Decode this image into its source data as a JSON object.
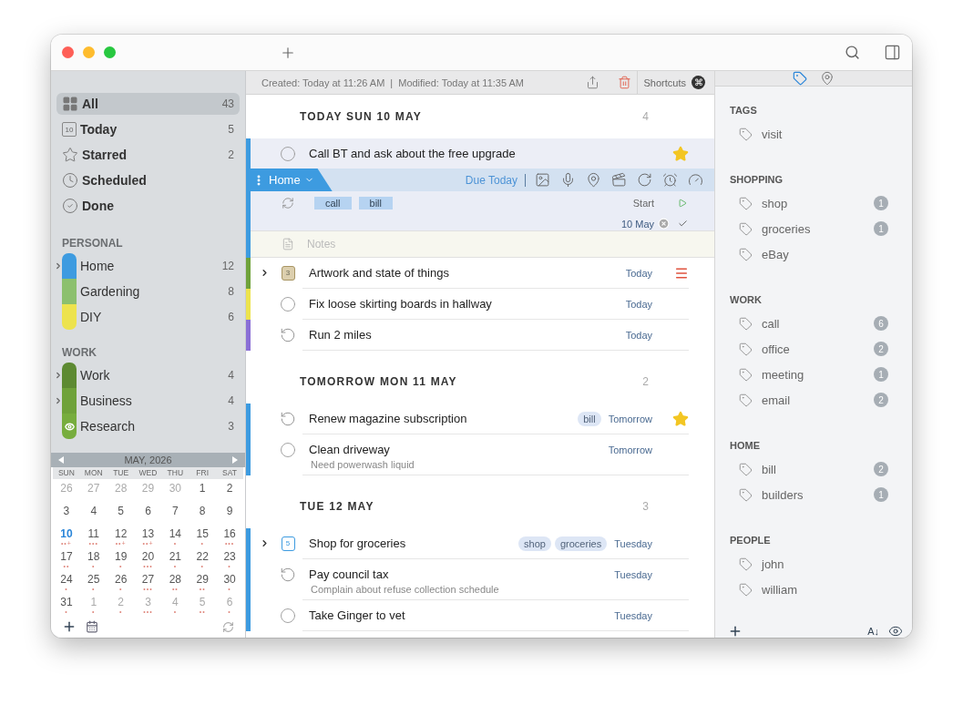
{
  "sidebar": {
    "smart_lists": [
      {
        "kind": "all",
        "label": "All",
        "count": "43",
        "selected": true
      },
      {
        "kind": "today",
        "label": "Today",
        "count": "5",
        "icon_text": "10",
        "selected": false
      },
      {
        "kind": "starred",
        "label": "Starred",
        "count": "2",
        "selected": false
      },
      {
        "kind": "scheduled",
        "label": "Scheduled",
        "selected": false
      },
      {
        "kind": "done",
        "label": "Done",
        "selected": false
      }
    ],
    "groups": [
      {
        "title": "PERSONAL",
        "lists": [
          {
            "label": "Home",
            "count": "12",
            "color": "#3d9be0",
            "expandable": true,
            "watched": false
          },
          {
            "label": "Gardening",
            "count": "8",
            "color": "#8cc06e",
            "expandable": false,
            "watched": false
          },
          {
            "label": "DIY",
            "count": "6",
            "color": "#ede34e",
            "expandable": false,
            "watched": false
          }
        ]
      },
      {
        "title": "WORK",
        "lists": [
          {
            "label": "Work",
            "count": "4",
            "color": "#5d8a32",
            "expandable": true,
            "watched": false
          },
          {
            "label": "Business",
            "count": "4",
            "color": "#6fa23a",
            "expandable": true,
            "watched": false
          },
          {
            "label": "Research",
            "count": "3",
            "color": "#77ad3e",
            "expandable": false,
            "watched": true
          }
        ]
      }
    ],
    "calendar": {
      "month": "MAY, 2026",
      "weekdays": [
        "SUN",
        "MON",
        "TUE",
        "WED",
        "THU",
        "FRI",
        "SAT"
      ],
      "weeks": [
        [
          {
            "day": "26",
            "in_month": false,
            "today": false
          },
          {
            "day": "27",
            "in_month": false,
            "today": false
          },
          {
            "day": "28",
            "in_month": false,
            "today": false
          },
          {
            "day": "29",
            "in_month": false,
            "today": false
          },
          {
            "day": "30",
            "in_month": false,
            "today": false
          },
          {
            "day": "1",
            "in_month": true,
            "today": false
          },
          {
            "day": "2",
            "in_month": true,
            "today": false
          }
        ],
        [
          {
            "day": "3",
            "in_month": true,
            "today": false
          },
          {
            "day": "4",
            "in_month": true,
            "today": false
          },
          {
            "day": "5",
            "in_month": true,
            "today": false
          },
          {
            "day": "6",
            "in_month": true,
            "today": false
          },
          {
            "day": "7",
            "in_month": true,
            "today": false
          },
          {
            "day": "8",
            "in_month": true,
            "today": false
          },
          {
            "day": "9",
            "in_month": true,
            "today": false
          }
        ],
        [
          {
            "day": "10",
            "in_month": true,
            "today": true,
            "marks": "••+"
          },
          {
            "day": "11",
            "in_month": true,
            "today": false,
            "marks": "•••"
          },
          {
            "day": "12",
            "in_month": true,
            "today": false,
            "marks": "••+"
          },
          {
            "day": "13",
            "in_month": true,
            "today": false,
            "marks": "••+"
          },
          {
            "day": "14",
            "in_month": true,
            "today": false,
            "marks": "•"
          },
          {
            "day": "15",
            "in_month": true,
            "today": false,
            "marks": "•"
          },
          {
            "day": "16",
            "in_month": true,
            "today": false,
            "marks": "•••"
          }
        ],
        [
          {
            "day": "17",
            "in_month": true,
            "today": false,
            "marks": "••"
          },
          {
            "day": "18",
            "in_month": true,
            "today": false,
            "marks": "•"
          },
          {
            "day": "19",
            "in_month": true,
            "today": false,
            "marks": "•"
          },
          {
            "day": "20",
            "in_month": true,
            "today": false,
            "marks": "•••"
          },
          {
            "day": "21",
            "in_month": true,
            "today": false,
            "marks": "•"
          },
          {
            "day": "22",
            "in_month": true,
            "today": false,
            "marks": "•"
          },
          {
            "day": "23",
            "in_month": true,
            "today": false,
            "marks": "•"
          }
        ],
        [
          {
            "day": "24",
            "in_month": true,
            "today": false,
            "marks": "•"
          },
          {
            "day": "25",
            "in_month": true,
            "today": false,
            "marks": "•"
          },
          {
            "day": "26",
            "in_month": true,
            "today": false,
            "marks": "•"
          },
          {
            "day": "27",
            "in_month": true,
            "today": false,
            "marks": "•••"
          },
          {
            "day": "28",
            "in_month": true,
            "today": false,
            "marks": "••"
          },
          {
            "day": "29",
            "in_month": true,
            "today": false,
            "marks": "••"
          },
          {
            "day": "30",
            "in_month": true,
            "today": false,
            "marks": "•"
          }
        ],
        [
          {
            "day": "31",
            "in_month": true,
            "today": false,
            "marks": "•"
          },
          {
            "day": "1",
            "in_month": false,
            "today": false,
            "marks": "•"
          },
          {
            "day": "2",
            "in_month": false,
            "today": false,
            "marks": "•"
          },
          {
            "day": "3",
            "in_month": false,
            "today": false,
            "marks": "•••"
          },
          {
            "day": "4",
            "in_month": false,
            "today": false,
            "marks": "•"
          },
          {
            "day": "5",
            "in_month": false,
            "today": false,
            "marks": "••"
          },
          {
            "day": "6",
            "in_month": false,
            "today": false,
            "marks": "•"
          }
        ]
      ]
    }
  },
  "info_bar": {
    "created": "Created: Today at 11:26 AM",
    "separator": "|",
    "modified": "Modified: Today at 11:35 AM",
    "shortcuts": "Shortcuts",
    "shortcuts_key": "⌘"
  },
  "sections": [
    {
      "title": "TODAY SUN 10 MAY",
      "count": "4",
      "tasks": [
        {
          "kind": "todo",
          "title": "Call BT and ask about the free upgrade",
          "color": "#3d9be0",
          "starred": true,
          "selected": true,
          "editor": {
            "project": "Home",
            "due": "Due Today",
            "tags": [
              "call",
              "bill"
            ],
            "start": "Start",
            "date": "10 May",
            "notes_placeholder": "Notes"
          }
        },
        {
          "kind": "project",
          "icon_text": "3",
          "title": "Artwork and state of things",
          "due": "Today",
          "color": "#6fa23a",
          "expandable": true,
          "menu": true,
          "starred": false,
          "selected": false
        },
        {
          "kind": "todo",
          "title": "Fix loose skirting boards in hallway",
          "due": "Today",
          "color": "#ede34e",
          "starred": false,
          "selected": false
        },
        {
          "kind": "repeat",
          "title": "Run 2 miles",
          "due": "Today",
          "color": "#8a6fd6",
          "starred": false,
          "selected": false
        }
      ]
    },
    {
      "title": "TOMORROW MON 11 MAY",
      "count": "2",
      "tasks": [
        {
          "kind": "repeat",
          "title": "Renew magazine subscription",
          "tags": [
            "bill"
          ],
          "due": "Tomorrow",
          "color": "#3d9be0",
          "starred": true,
          "selected": false
        },
        {
          "kind": "todo",
          "title": "Clean driveway",
          "due": "Tomorrow",
          "note": "Need powerwash liquid",
          "color": "#3d9be0",
          "starred": false,
          "selected": false
        }
      ]
    },
    {
      "title": "TUE 12 MAY",
      "count": "3",
      "tasks": [
        {
          "kind": "checklist",
          "icon_text": "5",
          "title": "Shop for groceries",
          "tags": [
            "shop",
            "groceries"
          ],
          "due": "Tuesday",
          "color": "#3d9be0",
          "expandable": true,
          "starred": false,
          "selected": false
        },
        {
          "kind": "repeat",
          "title": "Pay council tax",
          "due": "Tuesday",
          "note": "Complain about refuse collection schedule",
          "color": "#3d9be0",
          "starred": false,
          "selected": false
        },
        {
          "kind": "todo",
          "title": "Take Ginger to vet",
          "due": "Tuesday",
          "color": "#3d9be0",
          "starred": false,
          "selected": false
        }
      ]
    }
  ],
  "right_panel": {
    "tabs": [
      {
        "kind": "tags",
        "selected": true
      },
      {
        "kind": "places",
        "selected": false
      }
    ],
    "groups": [
      {
        "title": "TAGS",
        "tags": [
          {
            "label": "visit"
          }
        ]
      },
      {
        "title": "SHOPPING",
        "tags": [
          {
            "label": "shop",
            "count": "1"
          },
          {
            "label": "groceries",
            "count": "1"
          },
          {
            "label": "eBay"
          }
        ]
      },
      {
        "title": "WORK",
        "tags": [
          {
            "label": "call",
            "count": "6"
          },
          {
            "label": "office",
            "count": "2"
          },
          {
            "label": "meeting",
            "count": "1"
          },
          {
            "label": "email",
            "count": "2"
          }
        ]
      },
      {
        "title": "HOME",
        "tags": [
          {
            "label": "bill",
            "count": "2"
          },
          {
            "label": "builders",
            "count": "1"
          }
        ]
      },
      {
        "title": "PEOPLE",
        "tags": [
          {
            "label": "john"
          },
          {
            "label": "william"
          }
        ]
      }
    ],
    "sort_label": "A↓"
  }
}
